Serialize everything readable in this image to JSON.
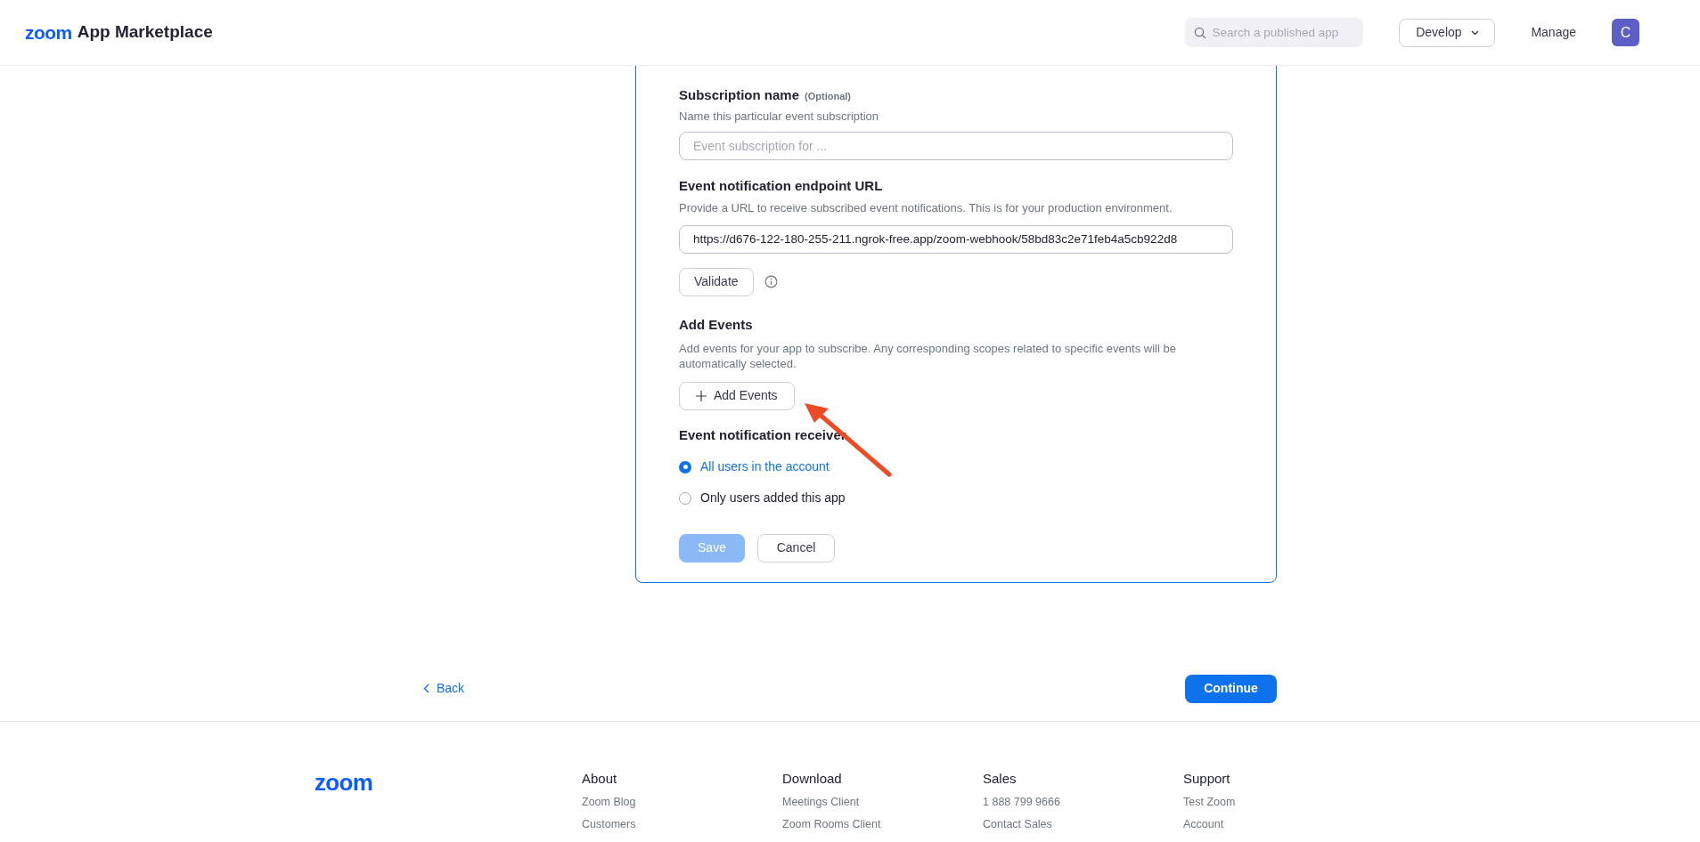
{
  "header": {
    "logo": "zoom",
    "title": "App Marketplace",
    "search": {
      "placeholder": "Search a published app"
    },
    "develop": "Develop",
    "manage": "Manage",
    "avatar": "C"
  },
  "form": {
    "subscription_name": {
      "label": "Subscription name",
      "optional": "(Optional)",
      "description": "Name this particular event subscription",
      "placeholder": "Event subscription for ..."
    },
    "endpoint": {
      "label": "Event notification endpoint URL",
      "description": "Provide a URL to receive subscribed event notifications. This is for your production environment.",
      "value": "https://d676-122-180-255-211.ngrok-free.app/zoom-webhook/58bd83c2e71feb4a5cb922d8",
      "validate": "Validate"
    },
    "add_events": {
      "label": "Add Events",
      "description": "Add events for your app to subscribe. Any corresponding scopes related to specific events will be automatically selected.",
      "button": "Add Events"
    },
    "receiver": {
      "label": "Event notification receiver",
      "options": [
        {
          "label": "All users in the account",
          "selected": true
        },
        {
          "label": "Only users added this app",
          "selected": false
        }
      ]
    },
    "save": {
      "label": "Save",
      "disabled": true
    },
    "cancel": "Cancel"
  },
  "nav": {
    "back": "Back",
    "continue": "Continue"
  },
  "footer": {
    "logo": "zoom",
    "columns": [
      {
        "heading": "About",
        "links": [
          "Zoom Blog",
          "Customers"
        ]
      },
      {
        "heading": "Download",
        "links": [
          "Meetings Client",
          "Zoom Rooms Client"
        ]
      },
      {
        "heading": "Sales",
        "links": [
          "1 888 799 9666",
          "Contact Sales"
        ]
      },
      {
        "heading": "Support",
        "links": [
          "Test Zoom",
          "Account"
        ]
      }
    ]
  }
}
